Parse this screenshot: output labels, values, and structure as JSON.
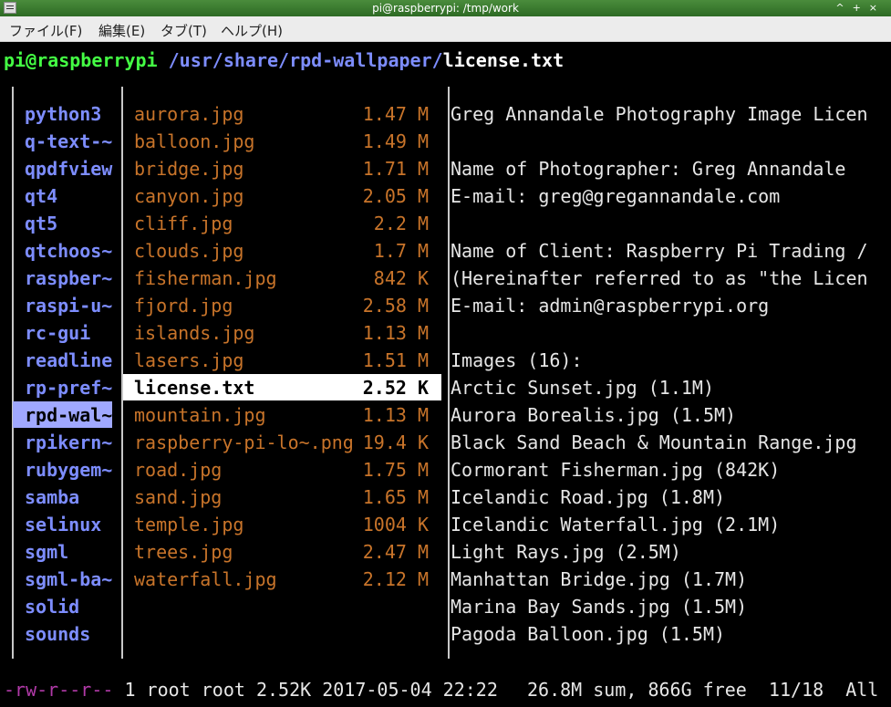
{
  "window": {
    "title": "pi@raspberrypi: /tmp/work",
    "controls": [
      "^",
      "+",
      "×"
    ]
  },
  "menu": [
    "ファイル(F)",
    "編集(E)",
    "タブ(T)",
    "ヘルプ(H)"
  ],
  "prompt": {
    "user_host": "pi@raspberrypi",
    "dir": " /usr/share/rpd-wallpaper/",
    "file": "license.txt"
  },
  "left_column": [
    "python3",
    "q-text-~",
    "qpdfview",
    "qt4",
    "qt5",
    "qtchoos~",
    "raspber~",
    "raspi-u~",
    "rc-gui",
    "readline",
    "rp-pref~",
    "rpd-wal~",
    "rpikern~",
    "rubygem~",
    "samba",
    "selinux",
    "sgml",
    "sgml-ba~",
    "solid",
    "sounds"
  ],
  "files": [
    {
      "name": "aurora.jpg",
      "size": "1.47 M"
    },
    {
      "name": "balloon.jpg",
      "size": "1.49 M"
    },
    {
      "name": "bridge.jpg",
      "size": "1.71 M"
    },
    {
      "name": "canyon.jpg",
      "size": "2.05 M"
    },
    {
      "name": "cliff.jpg",
      "size": "2.2 M"
    },
    {
      "name": "clouds.jpg",
      "size": "1.7 M"
    },
    {
      "name": "fisherman.jpg",
      "size": "842 K"
    },
    {
      "name": "fjord.jpg",
      "size": "2.58 M"
    },
    {
      "name": "islands.jpg",
      "size": "1.13 M"
    },
    {
      "name": "lasers.jpg",
      "size": "1.51 M"
    },
    {
      "name": "license.txt",
      "size": "2.52 K"
    },
    {
      "name": "mountain.jpg",
      "size": "1.13 M"
    },
    {
      "name": "raspberry-pi-lo~.png",
      "size": "19.4 K"
    },
    {
      "name": "road.jpg",
      "size": "1.75 M"
    },
    {
      "name": "sand.jpg",
      "size": "1.65 M"
    },
    {
      "name": "temple.jpg",
      "size": "1004 K"
    },
    {
      "name": "trees.jpg",
      "size": "2.47 M"
    },
    {
      "name": "waterfall.jpg",
      "size": "2.12 M"
    }
  ],
  "preview": [
    "Greg Annandale Photography Image Licen",
    "",
    "Name of Photographer: Greg Annandale",
    "E-mail: greg@gregannandale.com",
    "",
    "Name of Client: Raspberry Pi Trading /",
    "(Hereinafter referred to as \"the Licen",
    "E-mail: admin@raspberrypi.org",
    "",
    "Images (16):",
    "Arctic Sunset.jpg (1.1M)",
    "Aurora Borealis.jpg (1.5M)",
    "Black Sand Beach & Mountain Range.jpg",
    "Cormorant Fisherman.jpg (842K)",
    "Icelandic Road.jpg (1.8M)",
    "Icelandic Waterfall.jpg (2.1M)",
    "Light Rays.jpg (2.5M)",
    "Manhattan Bridge.jpg (1.7M)",
    "Marina Bay Sands.jpg (1.5M)",
    "Pagoda Balloon.jpg (1.5M)"
  ],
  "status": {
    "perm": "-rw-r--r--",
    "info": " 1 root root 2.52K 2017-05-04 22:22",
    "summary": "26.8M sum, 866G free  11/18  All"
  },
  "colors": {
    "directory": "#7d8dff",
    "file": "#c8742a",
    "prompt_user": "#44ff44",
    "selection": "#ffffff"
  }
}
